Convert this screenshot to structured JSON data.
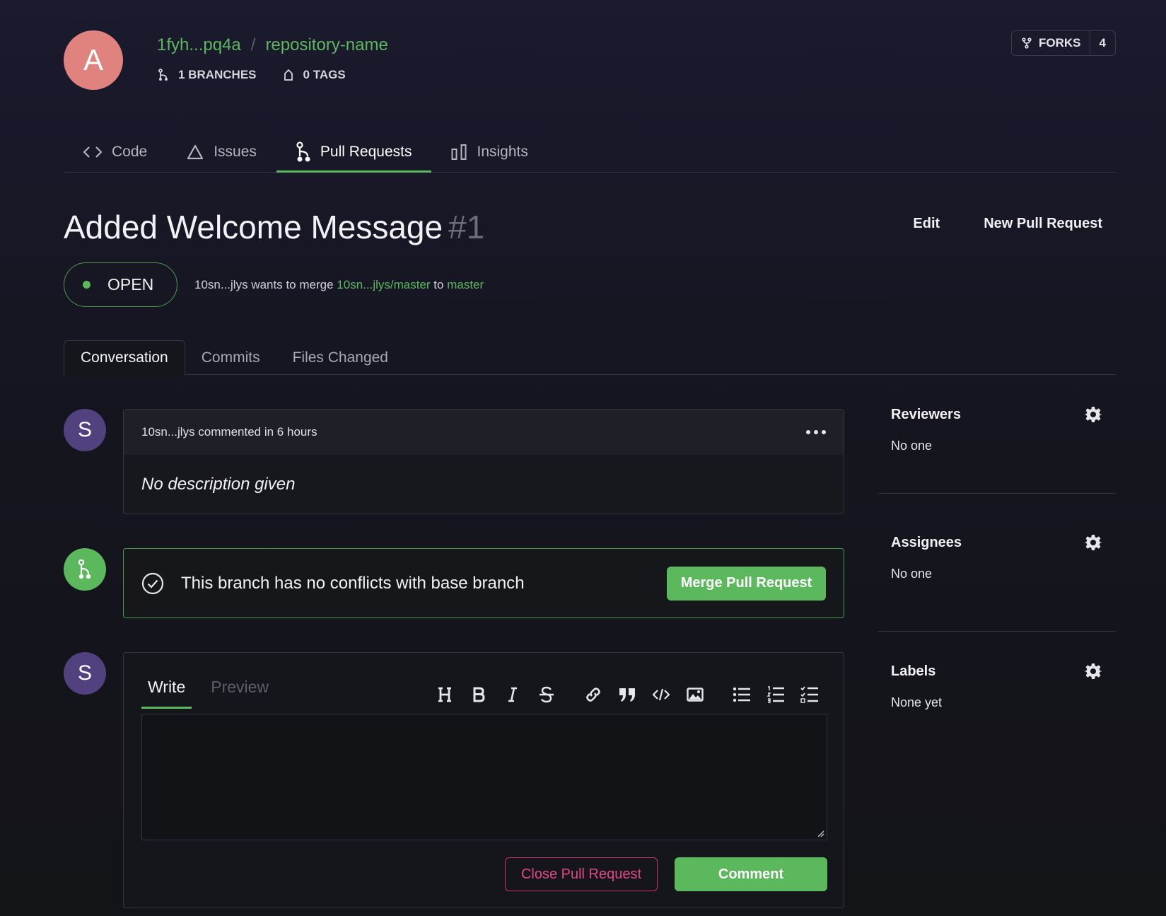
{
  "header": {
    "avatar_letter": "A",
    "owner": "1fyh...pq4a",
    "separator": "/",
    "repo": "repository-name",
    "branches": "1 BRANCHES",
    "tags": "0 TAGS",
    "forks_label": "FORKS",
    "forks_count": "4"
  },
  "nav": {
    "tabs": [
      {
        "label": "Code",
        "icon": "code-icon"
      },
      {
        "label": "Issues",
        "icon": "warning-triangle-icon"
      },
      {
        "label": "Pull Requests",
        "icon": "pull-request-icon",
        "active": true
      },
      {
        "label": "Insights",
        "icon": "bar-chart-icon"
      }
    ]
  },
  "pr": {
    "title": "Added Welcome Message",
    "number": "#1",
    "edit_label": "Edit",
    "new_pr_label": "New Pull Request",
    "status": "OPEN",
    "author": "10sn...jlys",
    "wants_to_merge": "wants to merge",
    "source_branch": "10sn...jlys/master",
    "to": "to",
    "target_branch": "master"
  },
  "subtabs": [
    "Conversation",
    "Commits",
    "Files Changed"
  ],
  "comment": {
    "avatar_letter": "S",
    "header": "10sn...jlys commented in 6 hours",
    "body": "No description given"
  },
  "merge": {
    "message": "This branch has no conflicts with base branch",
    "button": "Merge Pull Request"
  },
  "editor": {
    "avatar_letter": "S",
    "write_tab": "Write",
    "preview_tab": "Preview",
    "textarea_value": "",
    "close_button": "Close Pull Request",
    "comment_button": "Comment"
  },
  "sidebar": {
    "reviewers": {
      "title": "Reviewers",
      "value": "No one"
    },
    "assignees": {
      "title": "Assignees",
      "value": "No one"
    },
    "labels": {
      "title": "Labels",
      "value": "None yet"
    }
  },
  "colors": {
    "accent_green": "#5cb85c",
    "danger_pink": "#e04986",
    "avatar_owner": "#e0837e",
    "avatar_user": "#51427f"
  }
}
